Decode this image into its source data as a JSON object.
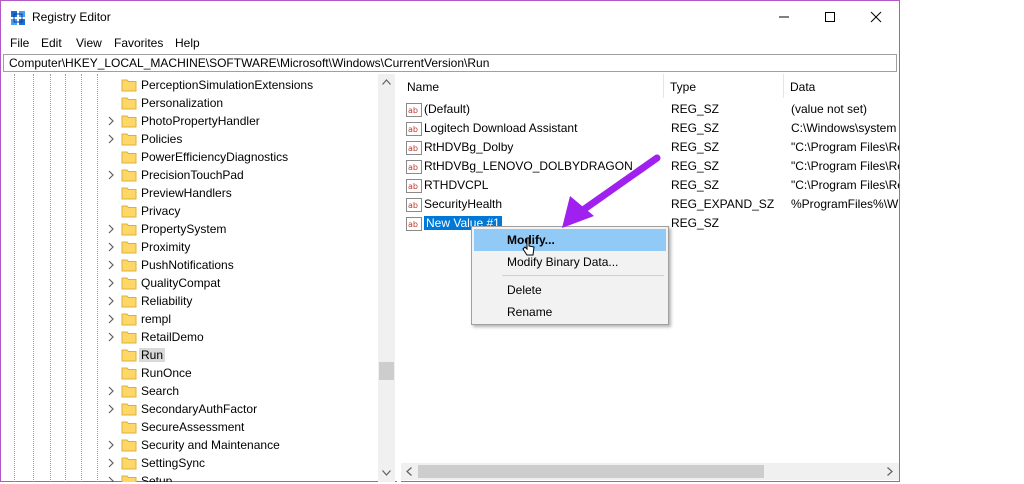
{
  "window": {
    "title": "Registry Editor",
    "controls": {
      "minimize": "minimize-icon",
      "maximize": "maximize-icon",
      "close": "close-icon"
    }
  },
  "menu": [
    "File",
    "Edit",
    "View",
    "Favorites",
    "Help"
  ],
  "address": "Computer\\HKEY_LOCAL_MACHINE\\SOFTWARE\\Microsoft\\Windows\\CurrentVersion\\Run",
  "tree": {
    "items": [
      {
        "label": "PerceptionSimulationExtensions",
        "expandable": false
      },
      {
        "label": "Personalization",
        "expandable": false
      },
      {
        "label": "PhotoPropertyHandler",
        "expandable": true
      },
      {
        "label": "Policies",
        "expandable": true
      },
      {
        "label": "PowerEfficiencyDiagnostics",
        "expandable": false
      },
      {
        "label": "PrecisionTouchPad",
        "expandable": true
      },
      {
        "label": "PreviewHandlers",
        "expandable": false
      },
      {
        "label": "Privacy",
        "expandable": false
      },
      {
        "label": "PropertySystem",
        "expandable": true
      },
      {
        "label": "Proximity",
        "expandable": true
      },
      {
        "label": "PushNotifications",
        "expandable": true
      },
      {
        "label": "QualityCompat",
        "expandable": true
      },
      {
        "label": "Reliability",
        "expandable": true
      },
      {
        "label": "rempl",
        "expandable": true
      },
      {
        "label": "RetailDemo",
        "expandable": true
      },
      {
        "label": "Run",
        "expandable": false,
        "selected": true
      },
      {
        "label": "RunOnce",
        "expandable": false
      },
      {
        "label": "Search",
        "expandable": true
      },
      {
        "label": "SecondaryAuthFactor",
        "expandable": true
      },
      {
        "label": "SecureAssessment",
        "expandable": false
      },
      {
        "label": "Security and Maintenance",
        "expandable": true
      },
      {
        "label": "SettingSync",
        "expandable": true
      },
      {
        "label": "Setup",
        "expandable": true
      }
    ]
  },
  "list": {
    "columns": [
      "Name",
      "Type",
      "Data"
    ],
    "rows": [
      {
        "name": "(Default)",
        "type": "REG_SZ",
        "data": "(value not set)"
      },
      {
        "name": "Logitech Download Assistant",
        "type": "REG_SZ",
        "data": "C:\\Windows\\system"
      },
      {
        "name": "RtHDVBg_Dolby",
        "type": "REG_SZ",
        "data": "\"C:\\Program Files\\Re"
      },
      {
        "name": "RtHDVBg_LENOVO_DOLBYDRAGON",
        "type": "REG_SZ",
        "data": "\"C:\\Program Files\\Re"
      },
      {
        "name": "RTHDVCPL",
        "type": "REG_SZ",
        "data": "\"C:\\Program Files\\Re"
      },
      {
        "name": "SecurityHealth",
        "type": "REG_EXPAND_SZ",
        "data": "%ProgramFiles%\\Wi"
      },
      {
        "name": "New Value #1",
        "type": "REG_SZ",
        "data": "",
        "selected": true
      }
    ]
  },
  "context_menu": {
    "items": [
      "Modify...",
      "Modify Binary Data...",
      "Delete",
      "Rename"
    ],
    "highlighted": "Modify..."
  },
  "annotation": {
    "arrow_color": "#a020f0"
  },
  "colors": {
    "selection": "#0078d7",
    "menu_highlight": "#91c9f7",
    "window_border": "#b259c3"
  }
}
